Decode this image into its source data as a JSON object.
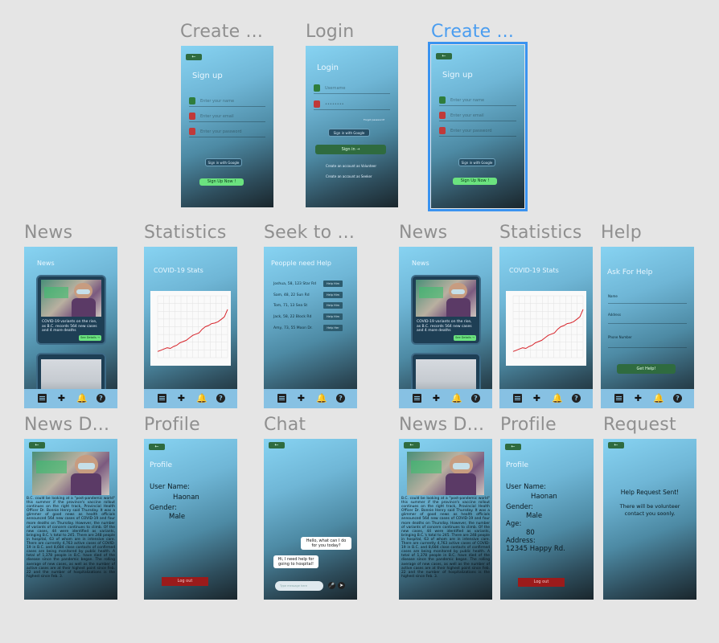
{
  "frames": {
    "create1": {
      "title": "Create ...",
      "back": "←",
      "heading": "Sign up",
      "fields": [
        "Enter your name",
        "Enter your email",
        "Enter your password"
      ],
      "google": "Sign in with Google",
      "cta": "Sign Up Now !"
    },
    "login": {
      "title": "Login",
      "heading": "Login",
      "fields": [
        "Username",
        "••••••••"
      ],
      "forgot": "Forgot password?",
      "google": "Sign in with Google",
      "cta": "Sign in →",
      "link1": "Create an account as Volunteer",
      "link2": "Create an account as Seeker"
    },
    "create2": {
      "title": "Create ...",
      "back": "←",
      "heading": "Sign up",
      "fields": [
        "Enter your name",
        "Enter your email",
        "Enter your password"
      ],
      "google": "Sign in with Google",
      "cta": "Sign Up Now !"
    },
    "news1": {
      "title": "News",
      "heading": "News",
      "card_text": "COVID-19 variants on the rise, as B.C. records 564 new cases and 4 more deaths",
      "see": "See Details →"
    },
    "stats1": {
      "title": "Statistics",
      "heading": "COVID-19 Stats"
    },
    "seek": {
      "title": "Seek to ...",
      "heading": "Peopple need Help",
      "rows": [
        {
          "text": "Joshua, 58, 123 Star Rd",
          "btn": "Help Him"
        },
        {
          "text": "Sam, 48, 22 Sun Rd",
          "btn": "Help Him"
        },
        {
          "text": "Tom, 71, 13 Sea St",
          "btn": "Help Him"
        },
        {
          "text": "Jack, 58, 22 Block Rd",
          "btn": "Help Him"
        },
        {
          "text": "Amy, 73, 55 Moon Dr.",
          "btn": "Help Her"
        }
      ]
    },
    "news2": {
      "title": "News",
      "heading": "News",
      "card_text": "COVID-19 variants on the rise, as B.C. records 564 new cases and 4 more deaths",
      "see": "See Details →"
    },
    "stats2": {
      "title": "Statistics",
      "heading": "COVID-19 Stats"
    },
    "help": {
      "title": "Help",
      "heading": "Ask For Help",
      "labels": [
        "Name",
        "Address",
        "Phone Number"
      ],
      "cta": "Get Help!"
    },
    "newsd1": {
      "title": "News D...",
      "back": "←",
      "article": "B.C. could be looking at a \"post-pandemic world\" this summer if the province's vaccine rollout continues on the right track, Provincial Health Officer Dr. Bonnie Henry said Thursday. It was a glimmer of good news as health officials announced 564 new cases of COVID-19 and four more deaths on Thursday. However, the number of variants of concern continues to climb. Of the new cases, 44 were identified as variants, bringing B.C.'s total to 245. There are 248 people in hospital, 63 of whom are in intensive care. There are currently 4,763 active cases of COVID-19 in B.C. and 8,684 close contacts of confirmed cases are being monitored by public health. A total of 1,378 people in B.C. have died of the disease since the pandemic began. The rolling average of new cases, as well as the number of active cases are at their highest point since Feb. 22 and the number of hospitalizations is the highest since Feb. 3."
    },
    "profile1": {
      "title": "Profile",
      "back": "←",
      "heading": "Profile",
      "user_label": "User Name:",
      "user": "Haonan",
      "gender_label": "Gender:",
      "gender": "Male",
      "logout": "Log out"
    },
    "chat": {
      "title": "Chat",
      "back": "←",
      "msg_in": "Hello, what can I do for you today?",
      "msg_out": "Hi, I need help for going to hospital!",
      "placeholder": "Type message here"
    },
    "newsd2": {
      "title": "News D...",
      "back": "←",
      "article": "B.C. could be looking at a \"post-pandemic world\" this summer if the province's vaccine rollout continues on the right track, Provincial Health Officer Dr. Bonnie Henry said Thursday. It was a glimmer of good news as health officials announced 564 new cases of COVID-19 and four more deaths on Thursday. However, the number of variants of concern continues to climb. Of the new cases, 44 were identified as variants, bringing B.C.'s total to 245. There are 248 people in hospital, 63 of whom are in intensive care. There are currently 4,763 active cases of COVID-19 in B.C. and 8,684 close contacts of confirmed cases are being monitored by public health. A total of 1,378 people in B.C. have died of the disease since the pandemic began. The rolling average of new cases, as well as the number of active cases are at their highest point since Feb. 22 and the number of hospitalizations is the highest since Feb. 3."
    },
    "profile2": {
      "title": "Profile",
      "back": "←",
      "heading": "Profile",
      "user_label": "User Name:",
      "user": "Haonan",
      "gender_label": "Gender:",
      "gender": "Male",
      "age_label": "Age:",
      "age": "80",
      "addr_label": "Address:",
      "addr": "12345 Happy Rd.",
      "logout": "Log out"
    },
    "request": {
      "title": "Request",
      "back": "←",
      "line1": "Help Request Sent!",
      "line2": "There will be volunteer contact you soonly."
    }
  },
  "tab_icons": [
    "news-icon",
    "hospital-plus-icon",
    "bell-icon",
    "help-icon"
  ],
  "chart_data": {
    "type": "line",
    "values": [
      10,
      12,
      14,
      16,
      15,
      18,
      20,
      24,
      26,
      28,
      32,
      36,
      38,
      40,
      46,
      50,
      52,
      55,
      56,
      58,
      62,
      66,
      78
    ],
    "ylim": [
      0,
      100
    ]
  }
}
